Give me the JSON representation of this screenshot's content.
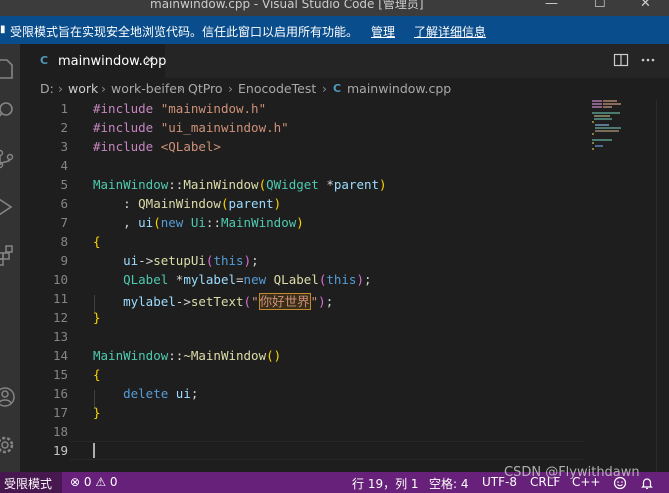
{
  "window": {
    "title": "mainwindow.cpp - Visual Studio Code [管理员]",
    "controls": [
      "—",
      "☐",
      "✕"
    ]
  },
  "banner": {
    "message": "受限模式旨在实现安全地浏览代码。信任此窗口以启用所有功能。",
    "manage": "管理",
    "learn_more": "了解详细信息"
  },
  "tab": {
    "file_icon": "C",
    "name": "mainwindow.cpp",
    "close": "×"
  },
  "tab_actions": [
    "split-editor-icon",
    "more-actions-icon"
  ],
  "breadcrumb": [
    "D:",
    "work",
    "work-beifen",
    "QtPro",
    "EnocodeTest",
    "mainwindow.cpp"
  ],
  "editor": {
    "lines": [
      "#include \"mainwindow.h\"",
      "#include \"ui_mainwindow.h\"",
      "#include <QLabel>",
      "",
      "MainWindow::MainWindow(QWidget *parent)",
      "    : QMainWindow(parent)",
      "    , ui(new Ui::MainWindow)",
      "{",
      "    ui->setupUi(this);",
      "    QLabel *mylabel=new QLabel(this);",
      "    mylabel->setText(\"你好世界\");",
      "}",
      "",
      "MainWindow::~MainWindow()",
      "{",
      "    delete ui;",
      "}",
      "",
      ""
    ],
    "active_line": 19
  },
  "status": {
    "restricted_mode": "受限模式",
    "problems": "⊗ 0 ⚠ 0",
    "position": "行 19，列 1",
    "spaces": "空格: 4",
    "encoding": "UTF-8",
    "eol": "CRLF",
    "language": "C++"
  },
  "watermark": "CSDN @Flywithdawn",
  "colors": {
    "status_bar": "#68217a",
    "banner": "#0a4d8c",
    "editor_bg": "#1e1e1e"
  }
}
